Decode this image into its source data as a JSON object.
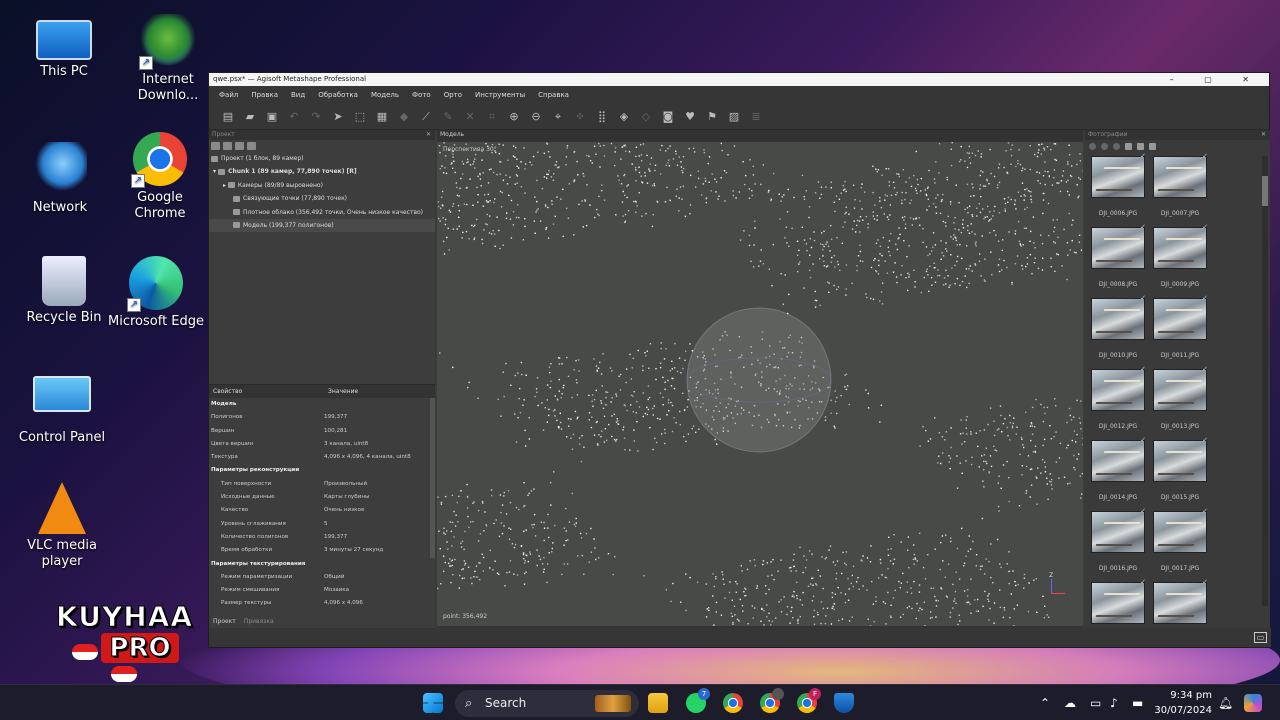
{
  "desktop": {
    "icons": [
      {
        "label": "This PC",
        "icon": "computer-icon"
      },
      {
        "label": "Internet Downlo...",
        "icon": "internet-download-manager-icon"
      },
      {
        "label": "Network",
        "icon": "network-icon"
      },
      {
        "label": "Google Chrome",
        "icon": "chrome-icon"
      },
      {
        "label": "Recycle Bin",
        "icon": "recycle-bin-icon"
      },
      {
        "label": "Microsoft Edge",
        "icon": "edge-icon"
      },
      {
        "label": "Control Panel",
        "icon": "control-panel-icon"
      },
      {
        "label": "VLC media player",
        "icon": "vlc-icon"
      }
    ],
    "brand": {
      "line1": "KUYHAA",
      "line2": "PRO"
    }
  },
  "app": {
    "title": "qwe.psx* — Agisoft Metashape Professional",
    "window_controls": [
      "–",
      "▢",
      "✕"
    ],
    "menu": [
      "Файл",
      "Правка",
      "Вид",
      "Обработка",
      "Модель",
      "Фото",
      "Орто",
      "Инструменты",
      "Справка"
    ],
    "project_pane_title": "Проект",
    "tree": {
      "root": "Проект (1 блок, 89 камер)",
      "chunk": "Chunk 1 (89 камер, 77,890 точек) [R]",
      "cameras": "Камеры (89/89 выровнено)",
      "tie_points": "Связующие точки (77,890 точек)",
      "dense_cloud": "Плотное облако (356,492 точки, Очень низкое качество)",
      "model": "Модель (199,377 полигонов)"
    },
    "properties": {
      "col_property": "Свойство",
      "col_value": "Значение",
      "rows": [
        {
          "k": "Модель",
          "v": "",
          "type": "group"
        },
        {
          "k": "Полигонов",
          "v": "199,377"
        },
        {
          "k": "Вершин",
          "v": "100,281"
        },
        {
          "k": "Цвета вершин",
          "v": "3 канала, uint8"
        },
        {
          "k": "Текстура",
          "v": "4,096 x 4,096, 4 канала, uint8"
        },
        {
          "k": "Параметры реконструкции",
          "v": "",
          "type": "group"
        },
        {
          "k": "Тип поверхности",
          "v": "Произвольный",
          "indent": true
        },
        {
          "k": "Исходные данные",
          "v": "Карты глубины",
          "indent": true
        },
        {
          "k": "Качество",
          "v": "Очень низкое",
          "indent": true
        },
        {
          "k": "Уровень сглаживания",
          "v": "5",
          "indent": true
        },
        {
          "k": "Количество полигонов",
          "v": "199,377",
          "indent": true
        },
        {
          "k": "Время обработки",
          "v": "3 минуты 27 секунд",
          "indent": true
        },
        {
          "k": "Параметры текстурирования",
          "v": "",
          "type": "group"
        },
        {
          "k": "Режим параметризации",
          "v": "Общий",
          "indent": true
        },
        {
          "k": "Режим смешивания",
          "v": "Мозаика",
          "indent": true
        },
        {
          "k": "Размер текстуры",
          "v": "4,096 x 4,096",
          "indent": true
        }
      ]
    },
    "left_tabs": [
      "Проект",
      "Привязка"
    ],
    "model_tab": "Модель",
    "viewport_label": "Перспектива 30°",
    "viewport_footer": "point: 356,492",
    "axis_label": "Z",
    "photos_pane_title": "Фотографии",
    "photos": [
      "DJI_0006.JPG",
      "DJI_0007.JPG",
      "DJI_0008.JPG",
      "DJI_0009.JPG",
      "DJI_0010.JPG",
      "DJI_0011.JPG",
      "DJI_0012.JPG",
      "DJI_0013.JPG",
      "DJI_0014.JPG",
      "DJI_0015.JPG",
      "DJI_0016.JPG",
      "DJI_0017.JPG",
      "",
      ""
    ]
  },
  "taskbar": {
    "search_placeholder": "Search",
    "whatsapp_badge": "7",
    "chrome2_badge": "F",
    "time": "9:34 pm",
    "date": "30/07/2024"
  }
}
